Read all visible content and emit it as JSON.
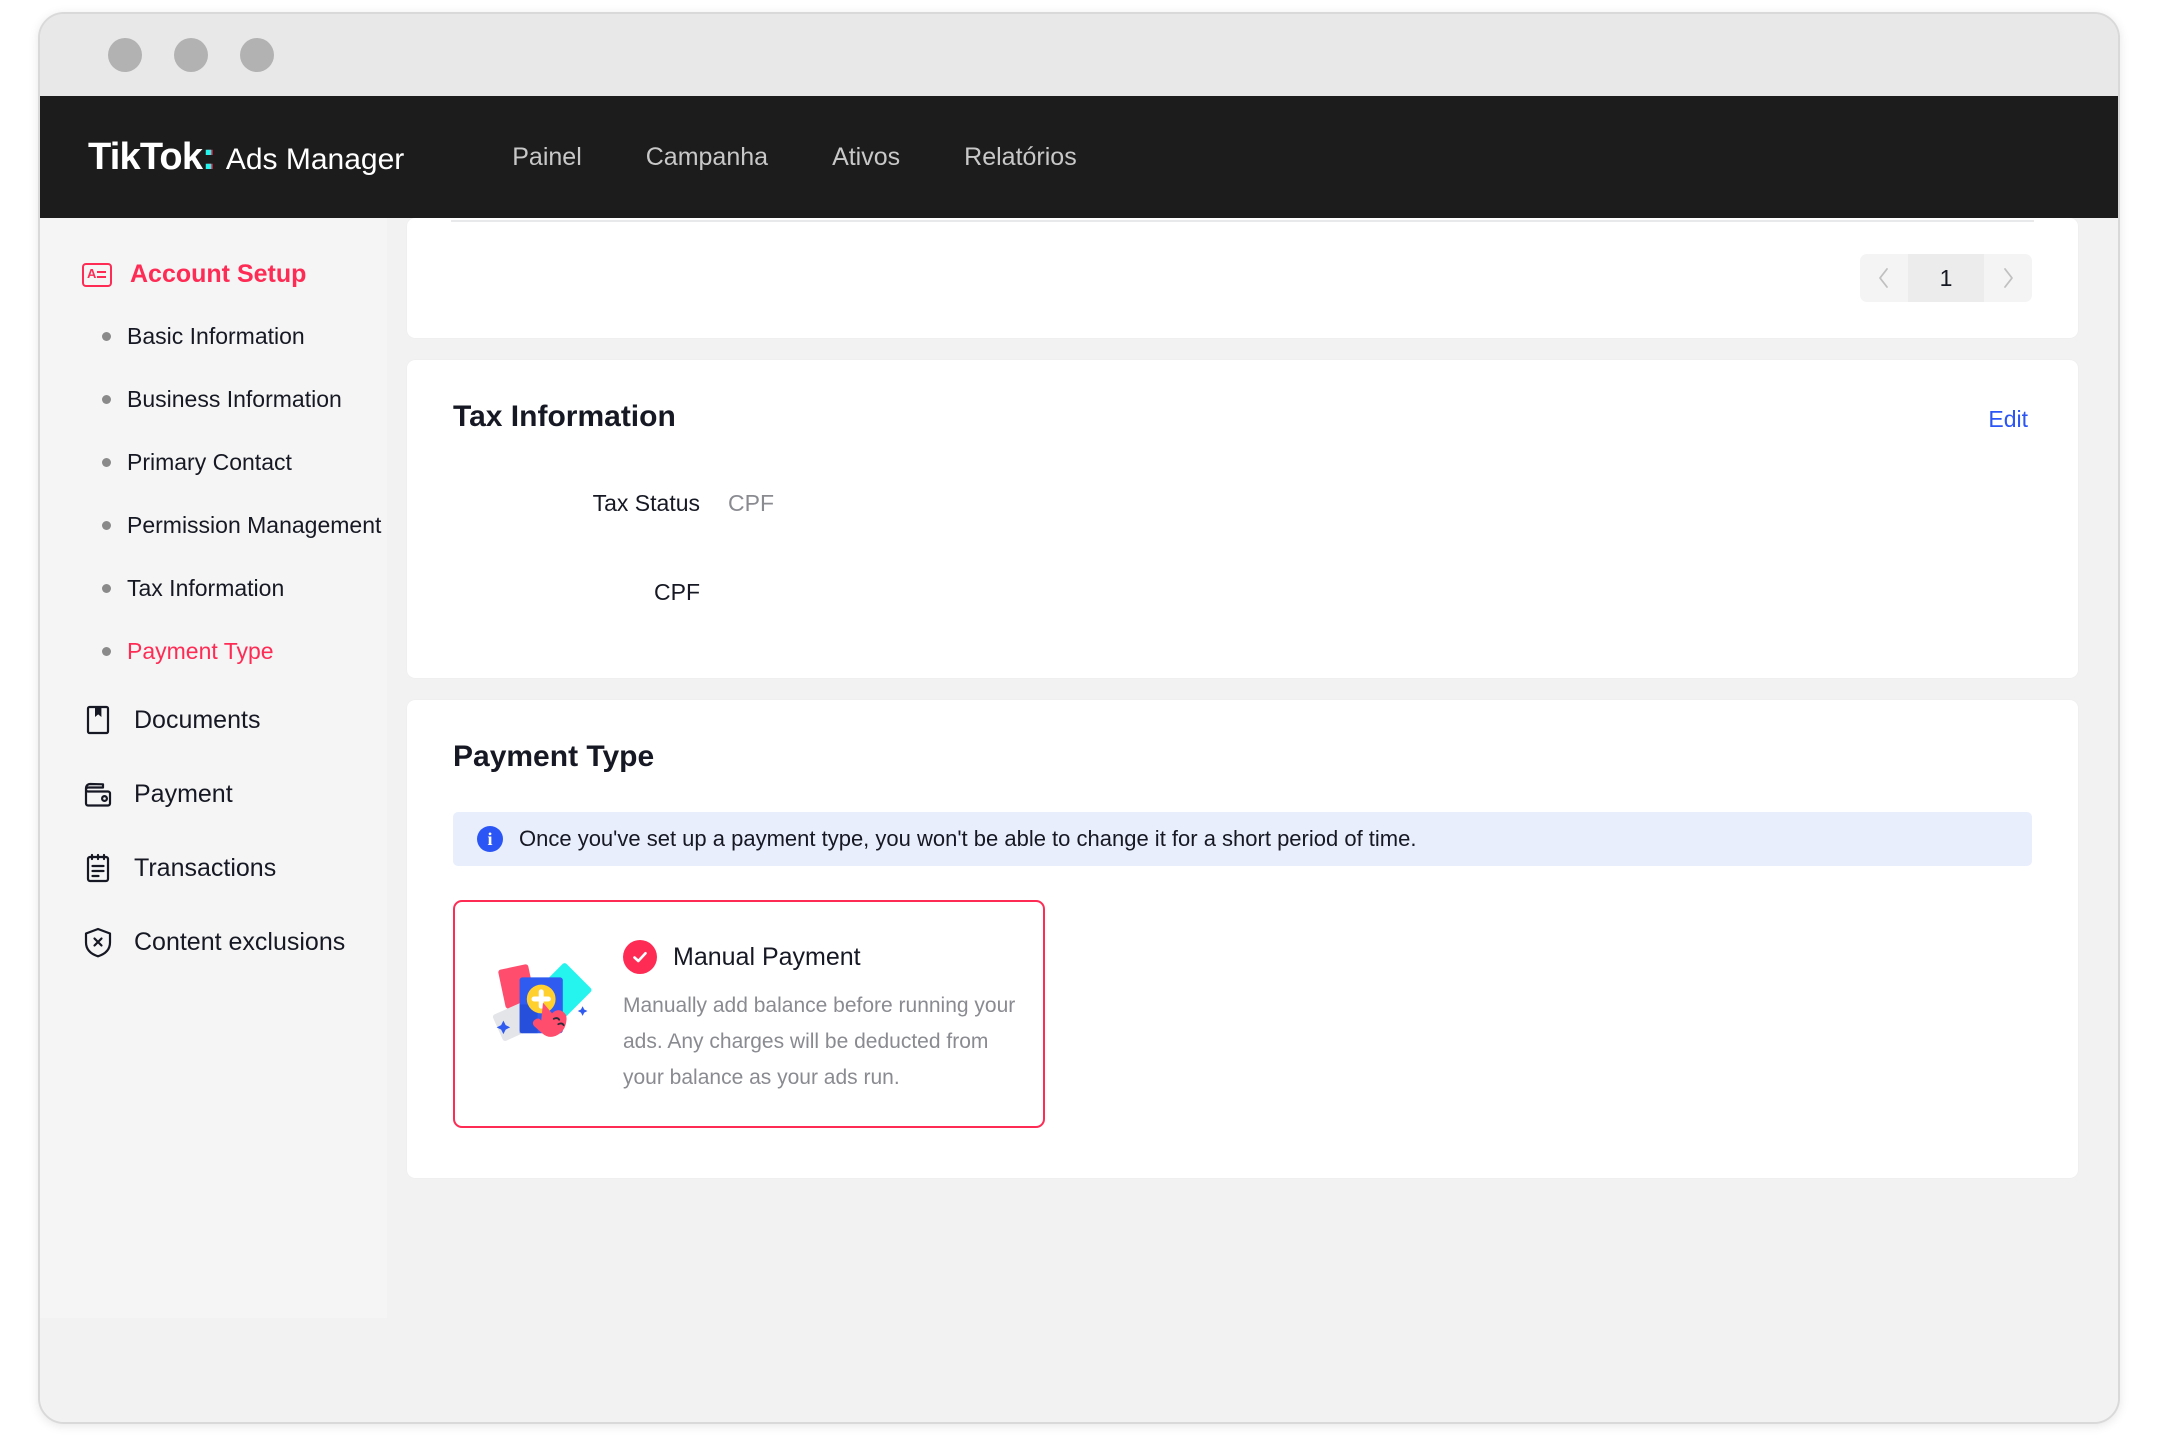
{
  "window": {
    "dots": [
      "close-dot",
      "minimize-dot",
      "maximize-dot"
    ]
  },
  "topnav": {
    "brand_primary": "TikTok",
    "brand_colon": ":",
    "brand_suffix": "Ads Manager",
    "links": [
      {
        "label": "Painel"
      },
      {
        "label": "Campanha"
      },
      {
        "label": "Ativos"
      },
      {
        "label": "Relatórios"
      }
    ]
  },
  "sidebar": {
    "header": {
      "label": "Account Setup",
      "icon": "account-badge-icon",
      "color": "#fe2c55"
    },
    "sub_items": [
      {
        "label": "Basic Information",
        "active": false
      },
      {
        "label": "Business Information",
        "active": false
      },
      {
        "label": "Primary Contact",
        "active": false
      },
      {
        "label": "Permission Management",
        "active": false
      },
      {
        "label": "Tax Information",
        "active": false
      },
      {
        "label": "Payment Type",
        "active": true
      }
    ],
    "main_items": [
      {
        "label": "Documents",
        "icon": "bookmark-document-icon"
      },
      {
        "label": "Payment",
        "icon": "wallet-icon"
      },
      {
        "label": "Transactions",
        "icon": "clipboard-list-icon"
      },
      {
        "label": "Content exclusions",
        "icon": "shield-x-icon"
      }
    ]
  },
  "pagination": {
    "prev_icon": "chevron-left-icon",
    "next_icon": "chevron-right-icon",
    "current_page": "1"
  },
  "tax_card": {
    "title": "Tax Information",
    "edit_label": "Edit",
    "status_label": "Tax Status",
    "status_value": "CPF",
    "second_row_value": "CPF"
  },
  "payment_card": {
    "title": "Payment Type",
    "notice_icon": "info-icon",
    "notice_text": "Once you've set up a payment type, you won't be able to change it for a short period of time.",
    "option": {
      "selected": true,
      "check_icon": "check-circle-icon",
      "illustration": "manual-payment-illustration",
      "title": "Manual Payment",
      "description": "Manually add balance before running your ads. Any charges will be deducted from your balance as your ads run."
    }
  },
  "colors": {
    "brand_pink": "#fe2c55",
    "brand_cyan": "#25f4ee",
    "link_blue": "#2b56f5",
    "nav_bg": "#1c1c1c",
    "page_bg": "#f2f2f2"
  }
}
